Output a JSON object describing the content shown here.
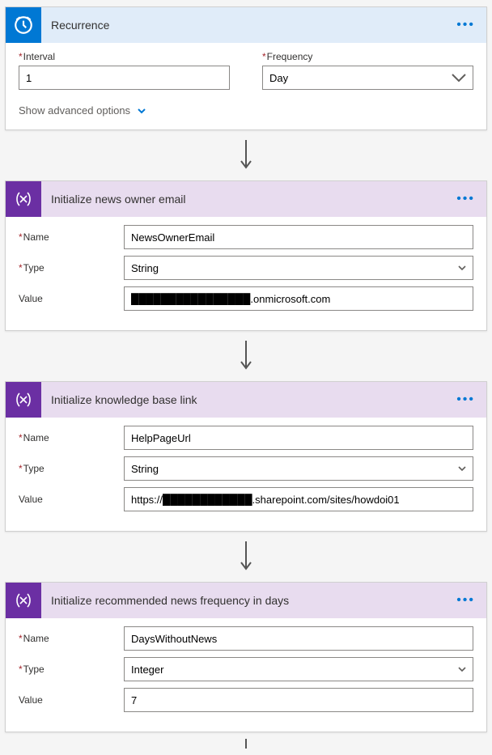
{
  "cards": {
    "recurrence": {
      "title": "Recurrence",
      "interval_label": "Interval",
      "interval_value": "1",
      "frequency_label": "Frequency",
      "frequency_value": "Day",
      "advanced": "Show advanced options"
    },
    "init_email": {
      "title": "Initialize news owner email",
      "name_label": "Name",
      "name_value": "NewsOwnerEmail",
      "type_label": "Type",
      "type_value": "String",
      "value_label": "Value",
      "value_value": "████████████████.onmicrosoft.com"
    },
    "init_kb": {
      "title": "Initialize knowledge base link",
      "name_label": "Name",
      "name_value": "HelpPageUrl",
      "type_label": "Type",
      "type_value": "String",
      "value_label": "Value",
      "value_value": "https://████████████.sharepoint.com/sites/howdoi01"
    },
    "init_days": {
      "title": "Initialize recommended news frequency in days",
      "name_label": "Name",
      "name_value": "DaysWithoutNews",
      "type_label": "Type",
      "type_value": "Integer",
      "value_label": "Value",
      "value_value": "7"
    }
  },
  "icons": {
    "clock": "clock",
    "variable": "variable"
  }
}
